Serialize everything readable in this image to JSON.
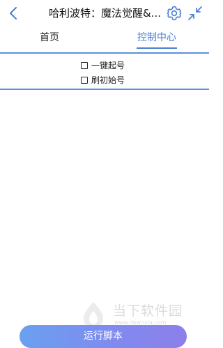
{
  "header": {
    "title": "哈利波特：魔法觉醒&...",
    "back_icon": "chevron-left-icon",
    "settings_icon": "gear-icon",
    "shrink_icon": "shrink-arrows-icon"
  },
  "tabs": [
    {
      "label": "首页",
      "active": false
    },
    {
      "label": "控制中心",
      "active": true
    }
  ],
  "options": [
    {
      "label": "一键起号",
      "checked": false
    },
    {
      "label": "刷初始号",
      "checked": false
    }
  ],
  "watermark": {
    "text": "当下软件园",
    "sub": "www.downxia.com"
  },
  "run_button": {
    "label": "运行脚本"
  },
  "colors": {
    "accent": "#4a7fd6",
    "divider": "#5b8fe0",
    "button_gradient_start": "#6aa0ef",
    "button_gradient_end": "#8d7fea"
  }
}
